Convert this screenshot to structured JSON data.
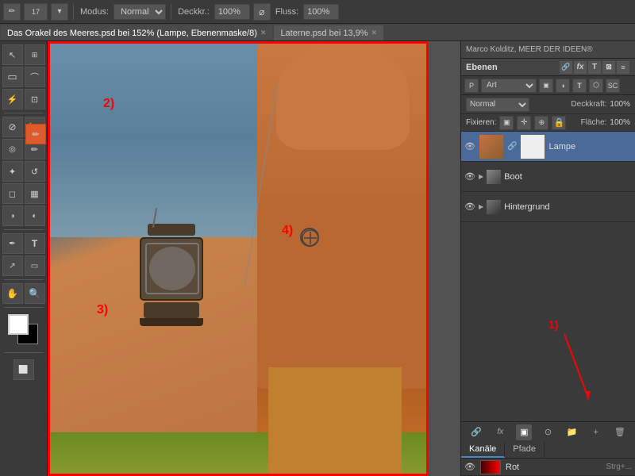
{
  "toolbar": {
    "modus_label": "Modus:",
    "modus_value": "Normal",
    "deckkr_label": "Deckkr.:",
    "deckkr_value": "100%",
    "fluss_label": "Fluss:",
    "fluss_value": "100%"
  },
  "tabs": [
    {
      "label": "Das Orakel des Meeres.psd bei 152% (Lampe, Ebenenmaske/8)",
      "active": true
    },
    {
      "label": "Laterne.psd bei 13,9%",
      "active": false
    }
  ],
  "user_bar": {
    "text": "Marco Kolditz, MEER DER IDEEN®"
  },
  "layers_panel": {
    "title": "Ebenen",
    "filter_label": "Art",
    "blend_mode": "Normal",
    "opacity_label": "Deckkraft:",
    "opacity_value": "100%",
    "flaeche_label": "Fläche:",
    "flaeche_value": "100%",
    "fixieren_label": "Fixieren:",
    "layers": [
      {
        "name": "Lampe",
        "visible": true,
        "active": true,
        "type": "layer_mask"
      },
      {
        "name": "Boot",
        "visible": true,
        "active": false,
        "type": "folder"
      },
      {
        "name": "Hintergrund",
        "visible": true,
        "active": false,
        "type": "folder"
      }
    ]
  },
  "sub_tabs": [
    "Kanäle",
    "Pfade"
  ],
  "channels": [
    {
      "name": "Rot",
      "shortcut": "Strg+..."
    }
  ],
  "annotations": {
    "num1": "1)",
    "num2": "2)",
    "num3": "3)",
    "num4": "4)"
  },
  "icons": {
    "eye": "👁",
    "chain": "🔗"
  }
}
